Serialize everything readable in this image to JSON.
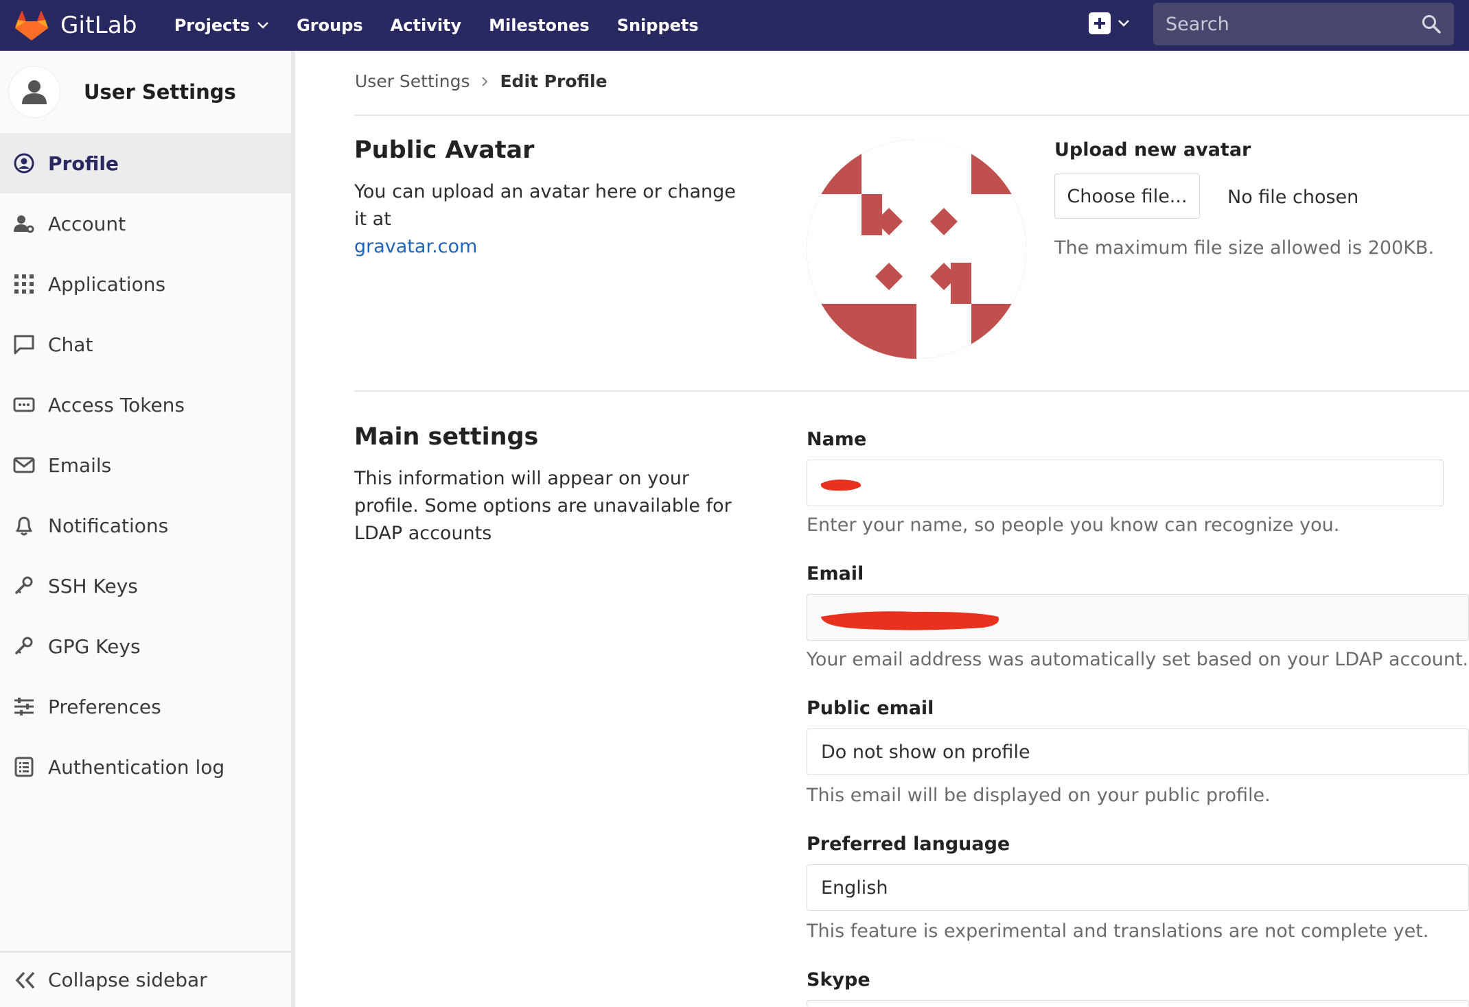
{
  "navbar": {
    "brand": "GitLab",
    "links": [
      {
        "label": "Projects",
        "has_dropdown": true
      },
      {
        "label": "Groups"
      },
      {
        "label": "Activity"
      },
      {
        "label": "Milestones"
      },
      {
        "label": "Snippets"
      }
    ],
    "search_placeholder": "Search",
    "colors": {
      "background": "#292961",
      "search_bg": "#48486e"
    }
  },
  "sidebar": {
    "title": "User Settings",
    "items": [
      {
        "label": "Profile",
        "icon": "profile-icon",
        "active": true
      },
      {
        "label": "Account",
        "icon": "account-icon"
      },
      {
        "label": "Applications",
        "icon": "applications-grid-icon"
      },
      {
        "label": "Chat",
        "icon": "chat-icon"
      },
      {
        "label": "Access Tokens",
        "icon": "token-icon"
      },
      {
        "label": "Emails",
        "icon": "mail-icon"
      },
      {
        "label": "Notifications",
        "icon": "bell-icon"
      },
      {
        "label": "SSH Keys",
        "icon": "key-icon"
      },
      {
        "label": "GPG Keys",
        "icon": "key-icon"
      },
      {
        "label": "Preferences",
        "icon": "sliders-icon"
      },
      {
        "label": "Authentication log",
        "icon": "log-icon"
      }
    ],
    "collapse_label": "Collapse sidebar"
  },
  "breadcrumb": {
    "parent": "User Settings",
    "current": "Edit Profile"
  },
  "avatar_section": {
    "title": "Public Avatar",
    "description": "You can upload an avatar here or change it at",
    "link_text": "gravatar.com",
    "upload_label": "Upload new avatar",
    "choose_button": "Choose file...",
    "no_file": "No file chosen",
    "max_size_help": "The maximum file size allowed is 200KB.",
    "avatar_color": "#c0504d"
  },
  "main_settings": {
    "title": "Main settings",
    "description": "This information will appear on your profile. Some options are unavailable for LDAP accounts",
    "fields": {
      "name": {
        "label": "Name",
        "help": "Enter your name, so people you know can recognize you."
      },
      "email": {
        "label": "Email",
        "help": "Your email address was automatically set based on your LDAP account."
      },
      "public_email": {
        "label": "Public email",
        "value": "Do not show on profile",
        "help": "This email will be displayed on your public profile."
      },
      "language": {
        "label": "Preferred language",
        "value": "English",
        "help": "This feature is experimental and translations are not complete yet."
      },
      "skype": {
        "label": "Skype"
      }
    },
    "redaction_color": "#e8321f"
  }
}
